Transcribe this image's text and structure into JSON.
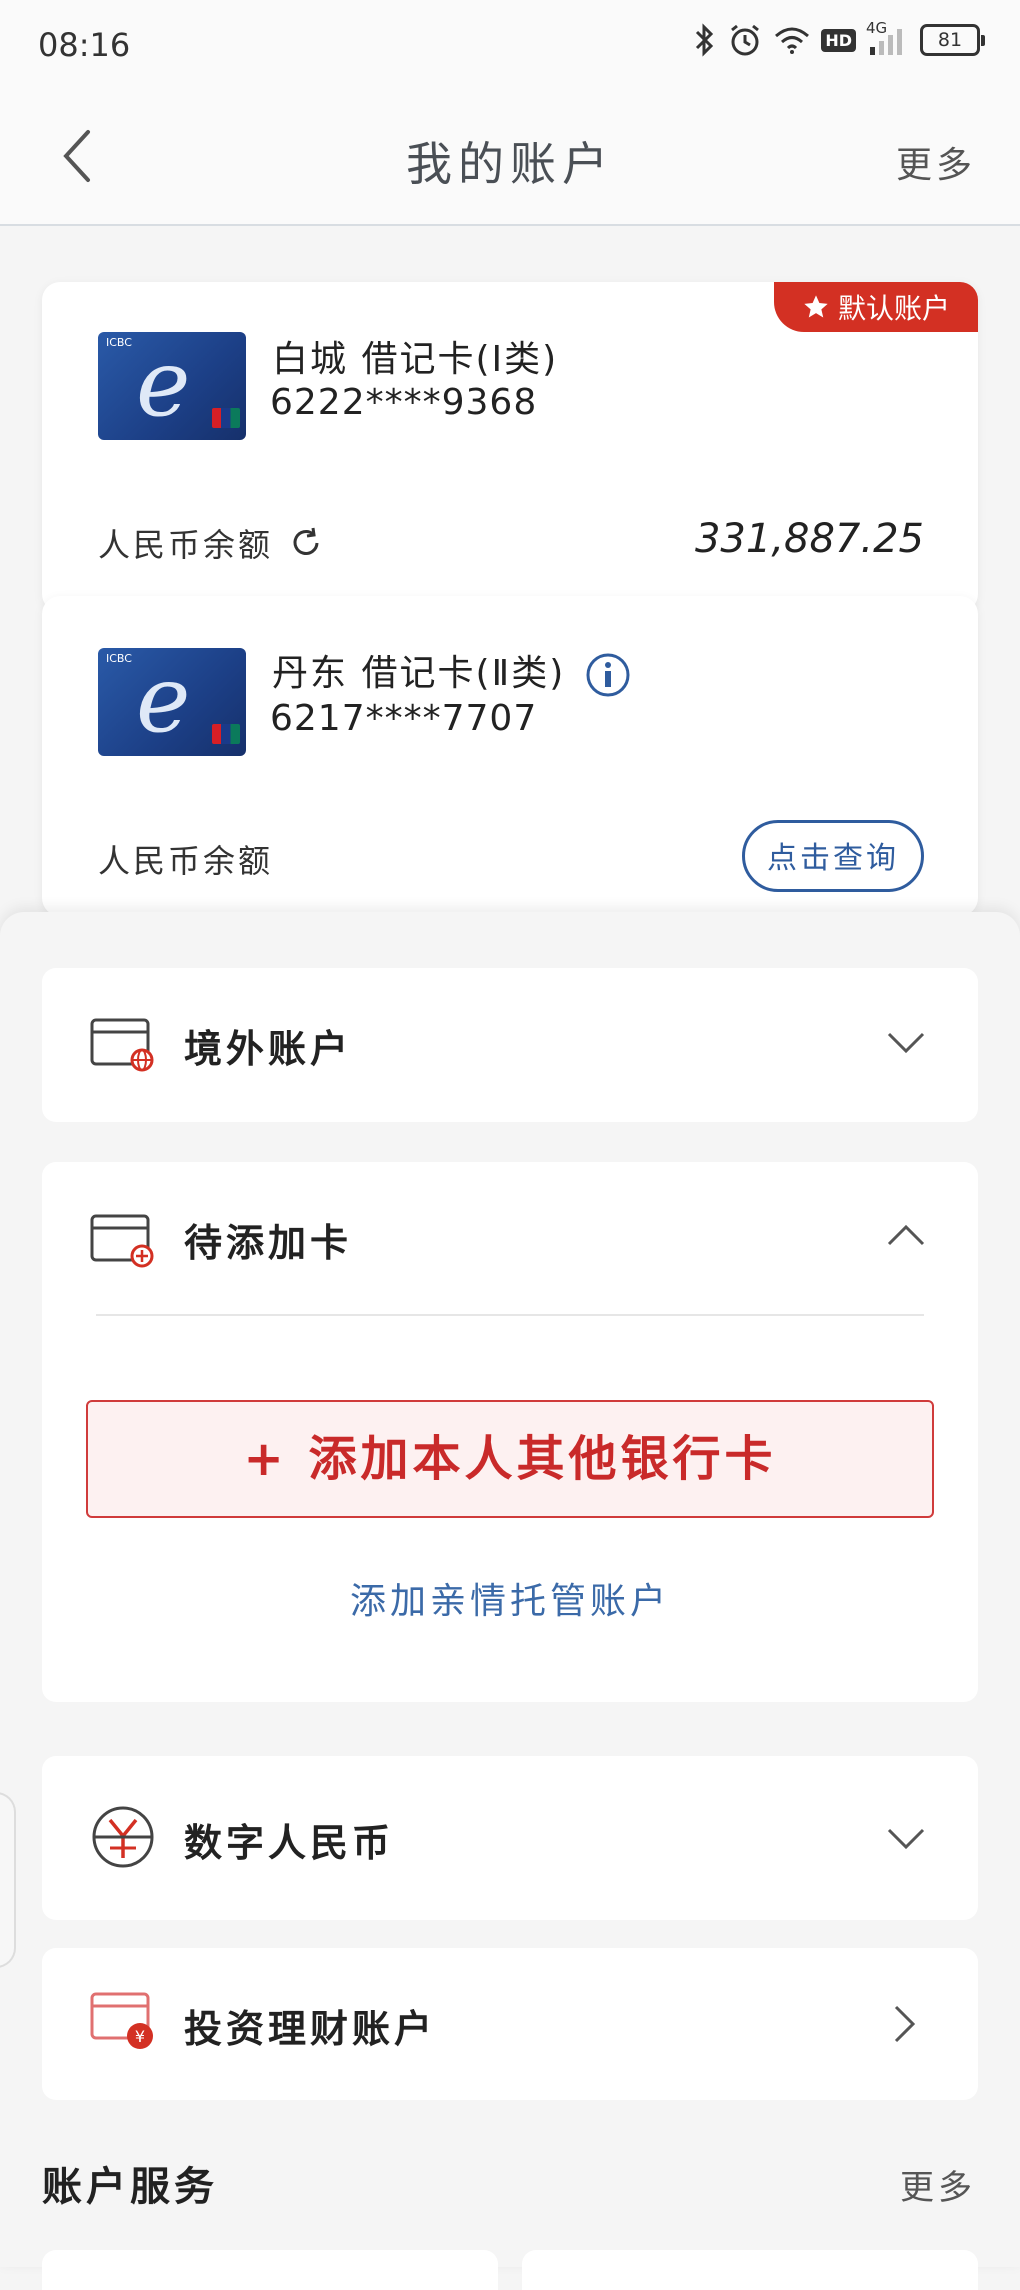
{
  "status_bar": {
    "time": "08:16",
    "hd_label": "HD",
    "network": "4G",
    "battery": "81"
  },
  "header": {
    "title": "我的账户",
    "more_label": "更多"
  },
  "accounts": [
    {
      "default_tag": "默认账户",
      "name": "白城 借记卡(Ⅰ类)",
      "number": "6222****9368",
      "balance_label": "人民币余额",
      "balance_value": "331,887.25"
    },
    {
      "name": "丹东 借记卡(Ⅱ类)",
      "number": "6217****7707",
      "balance_label": "人民币余额",
      "query_label": "点击查询"
    }
  ],
  "sections": {
    "overseas": {
      "title": "境外账户"
    },
    "pending": {
      "title": "待添加卡",
      "add_bank_label": "+ 添加本人其他银行卡",
      "add_family_label": "添加亲情托管账户"
    },
    "digital_rmb": {
      "title": "数字人民币"
    },
    "investment": {
      "title": "投资理财账户"
    }
  },
  "account_services": {
    "title": "账户服务",
    "more_label": "更多"
  },
  "colors": {
    "accent_red": "#d33023",
    "link_blue": "#2f5c9e",
    "background": "#f5f5f5"
  }
}
